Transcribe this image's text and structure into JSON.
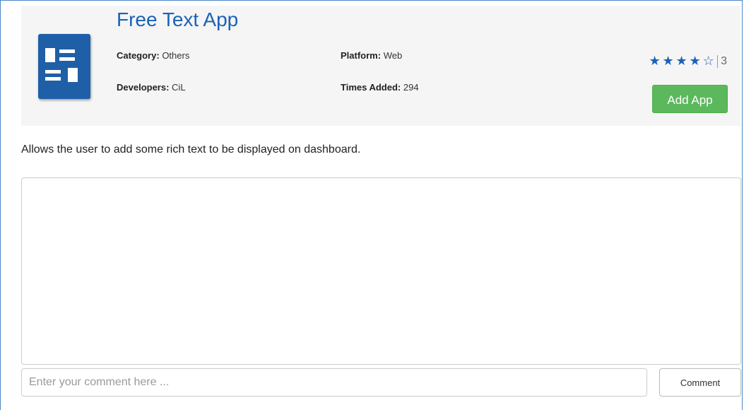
{
  "app": {
    "title": "Free Text App",
    "category_label": "Category:",
    "category_value": "Others",
    "platform_label": "Platform:",
    "platform_value": "Web",
    "developers_label": "Developers:",
    "developers_value": "CiL",
    "times_added_label": "Times Added:",
    "times_added_value": "294",
    "icon": "free-text-app-icon",
    "icon_color": "#1f5fa8"
  },
  "rating": {
    "stars_filled": 4,
    "stars_total": 5,
    "count": "3",
    "filled_star": "★",
    "empty_star": "☆",
    "color": "#1a63b8"
  },
  "actions": {
    "add_app_label": "Add App",
    "add_app_color": "#5cb85c"
  },
  "description": "Allows the user to add some rich text to be displayed on dashboard.",
  "comments": {
    "input_placeholder": "Enter your comment here ...",
    "input_value": "",
    "submit_label": "Comment"
  },
  "colors": {
    "title": "#1a63b8",
    "panel_background": "#f5f5f5"
  }
}
